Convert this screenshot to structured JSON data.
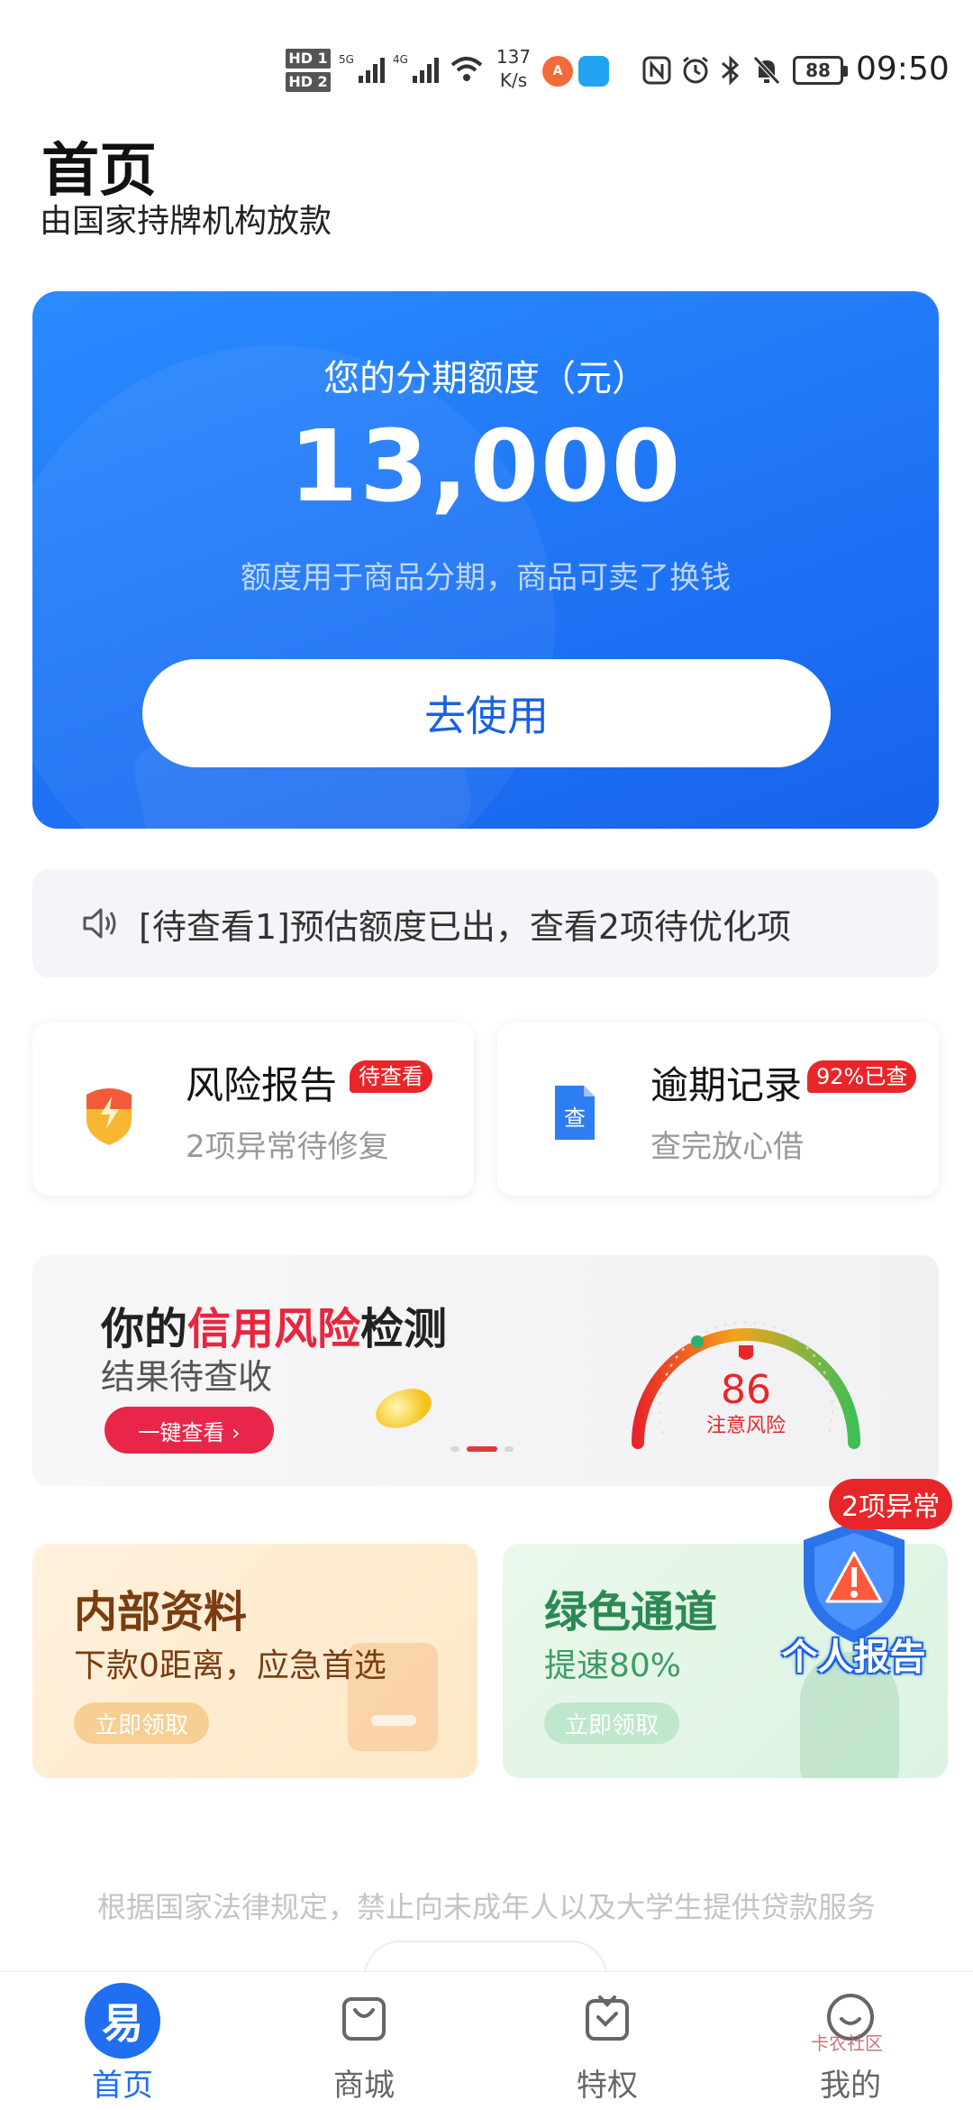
{
  "status_bar": {
    "hd1": "HD 1",
    "hd2": "HD 2",
    "sig1": "5G",
    "sig2": "4G",
    "speed_value": "137",
    "speed_unit": "K/s",
    "battery": "88",
    "time": "09:50"
  },
  "header": {
    "title": "首页",
    "subtitle": "由国家持牌机构放款"
  },
  "quota": {
    "label": "您的分期额度（元）",
    "amount": "13,000",
    "desc": "额度用于商品分期，商品可卖了换钱",
    "button": "去使用"
  },
  "notice": {
    "text": "[待查看1]预估额度已出，查看2项待优化项"
  },
  "cards": [
    {
      "title": "风险报告",
      "badge": "待查看",
      "sub": "2项异常待修复",
      "icon": "shield-lightning-icon"
    },
    {
      "title": "逾期记录",
      "badge": "92%已查",
      "sub": "查完放心借",
      "icon": "document-check-icon",
      "icon_text": "查"
    }
  ],
  "credit_banner": {
    "title_prefix": "你的",
    "title_highlight": "信用风险",
    "title_suffix": "检测",
    "sub": "结果待查收",
    "button": "一键查看 ›",
    "score": "86",
    "score_label": "注意风险",
    "score_value": 86
  },
  "promos": [
    {
      "title": "内部资料",
      "sub": "下款0距离，应急首选",
      "button": "立即领取"
    },
    {
      "title": "绿色通道",
      "sub": "提速80%",
      "button": "立即领取"
    }
  ],
  "floating_report": {
    "badge": "2项异常",
    "label": "个人报告"
  },
  "legal": "根据国家法律规定，禁止向未成年人以及大学生提供贷款服务",
  "nav": {
    "home": "首页",
    "home_icon_char": "易",
    "mall": "商城",
    "privilege": "特权",
    "mine": "我的"
  },
  "watermark": "卡农社区",
  "colors": {
    "primary": "#1f6ff0",
    "danger": "#e8262a",
    "card_blue": "#2a8bff"
  }
}
